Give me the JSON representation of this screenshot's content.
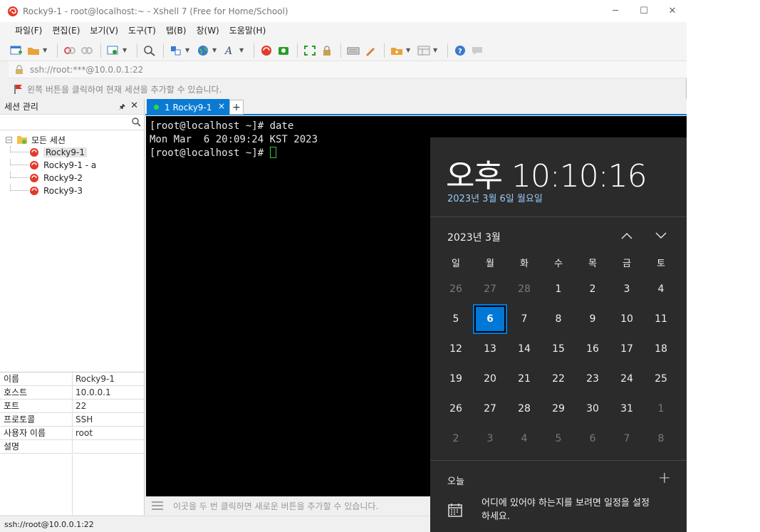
{
  "window": {
    "title": "Rocky9-1 - root@localhost:~ - Xshell 7 (Free for Home/School)",
    "controls": [
      "─",
      "☐",
      "✕"
    ]
  },
  "menu": [
    "파일(F)",
    "편집(E)",
    "보기(V)",
    "도구(T)",
    "탭(B)",
    "창(W)",
    "도움말(H)"
  ],
  "address": {
    "value": "ssh://root:***@10.0.0.1:22"
  },
  "hint": "왼쪽 버튼을 클릭하여 현재 세션을 추가할 수 있습니다.",
  "session_panel": {
    "title": "세션 관리",
    "pin": "🖈",
    "close": "✕",
    "root": "모든 세션",
    "sessions": [
      "Rocky9-1",
      "Rocky9-1 - a",
      "Rocky9-2",
      "Rocky9-3"
    ],
    "selected_index": 0
  },
  "properties": [
    {
      "key": "이름",
      "value": "Rocky9-1"
    },
    {
      "key": "호스트",
      "value": "10.0.0.1"
    },
    {
      "key": "포트",
      "value": "22"
    },
    {
      "key": "프로토콜",
      "value": "SSH"
    },
    {
      "key": "사용자 이름",
      "value": "root"
    },
    {
      "key": "설명",
      "value": ""
    }
  ],
  "tab": {
    "label": "1 Rocky9-1",
    "close": "×",
    "add": "+"
  },
  "terminal": {
    "lines": [
      "[root@localhost ~]# date",
      "Mon Mar  6 20:09:24 KST 2023",
      "[root@localhost ~]# "
    ]
  },
  "compose_hint": "이곳을 두 번 클릭하면 새로운 버튼을 추가할 수 있습니다.",
  "status": "ssh://root@10.0.0.1:22",
  "clock": {
    "time": "오후 10:10:16",
    "date": "2023년 3월 6일 월요일",
    "month": "2023년 3월",
    "weekdays": [
      "일",
      "월",
      "화",
      "수",
      "목",
      "금",
      "토"
    ],
    "weeks": [
      [
        "26",
        "27",
        "28",
        "1",
        "2",
        "3",
        "4"
      ],
      [
        "5",
        "6",
        "7",
        "8",
        "9",
        "10",
        "11"
      ],
      [
        "12",
        "13",
        "14",
        "15",
        "16",
        "17",
        "18"
      ],
      [
        "19",
        "20",
        "21",
        "22",
        "23",
        "24",
        "25"
      ],
      [
        "26",
        "27",
        "28",
        "29",
        "30",
        "31",
        "1"
      ],
      [
        "2",
        "3",
        "4",
        "5",
        "6",
        "7",
        "8"
      ]
    ],
    "today_label": "오늘",
    "add": "+",
    "event_hint": "어디에 있어야 하는지를 보려면 일정을 설정하세요."
  }
}
